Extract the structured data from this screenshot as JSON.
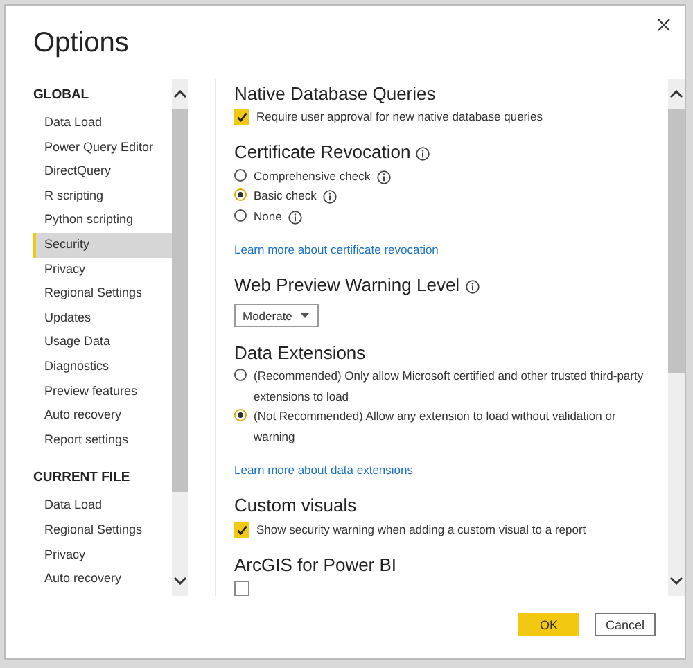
{
  "window": {
    "title": "Options"
  },
  "sidebar": {
    "sections": [
      {
        "heading": "GLOBAL",
        "items": [
          {
            "label": "Data Load",
            "selected": false
          },
          {
            "label": "Power Query Editor",
            "selected": false
          },
          {
            "label": "DirectQuery",
            "selected": false
          },
          {
            "label": "R scripting",
            "selected": false
          },
          {
            "label": "Python scripting",
            "selected": false
          },
          {
            "label": "Security",
            "selected": true
          },
          {
            "label": "Privacy",
            "selected": false
          },
          {
            "label": "Regional Settings",
            "selected": false
          },
          {
            "label": "Updates",
            "selected": false
          },
          {
            "label": "Usage Data",
            "selected": false
          },
          {
            "label": "Diagnostics",
            "selected": false
          },
          {
            "label": "Preview features",
            "selected": false
          },
          {
            "label": "Auto recovery",
            "selected": false
          },
          {
            "label": "Report settings",
            "selected": false
          }
        ]
      },
      {
        "heading": "CURRENT FILE",
        "items": [
          {
            "label": "Data Load",
            "selected": false
          },
          {
            "label": "Regional Settings",
            "selected": false
          },
          {
            "label": "Privacy",
            "selected": false
          },
          {
            "label": "Auto recovery",
            "selected": false
          }
        ]
      }
    ]
  },
  "content": {
    "sections": [
      {
        "title": "Native Database Queries",
        "info": false,
        "items": [
          {
            "kind": "checkbox",
            "label": "Require user approval for new native database queries",
            "checked": true
          }
        ]
      },
      {
        "title": "Certificate Revocation",
        "info": true,
        "items": [
          {
            "kind": "radio",
            "label": "Comprehensive check",
            "info": true,
            "selected": false
          },
          {
            "kind": "radio",
            "label": "Basic check",
            "info": true,
            "selected": true
          },
          {
            "kind": "radio",
            "label": "None",
            "info": true,
            "selected": false
          },
          {
            "kind": "link",
            "label": "Learn more about certificate revocation"
          }
        ]
      },
      {
        "title": "Web Preview Warning Level",
        "info": true,
        "items": [
          {
            "kind": "dropdown",
            "value": "Moderate"
          }
        ]
      },
      {
        "title": "Data Extensions",
        "info": false,
        "items": [
          {
            "kind": "radio",
            "label": "(Recommended) Only allow Microsoft certified and other trusted third-party extensions to load",
            "info": false,
            "selected": false
          },
          {
            "kind": "radio",
            "label": "(Not Recommended) Allow any extension to load without validation or warning",
            "info": false,
            "selected": true
          },
          {
            "kind": "link",
            "label": "Learn more about data extensions"
          }
        ]
      },
      {
        "title": "Custom visuals",
        "info": false,
        "items": [
          {
            "kind": "checkbox",
            "label": "Show security warning when adding a custom visual to a report",
            "checked": true
          }
        ]
      },
      {
        "title": "ArcGIS for Power BI",
        "info": false,
        "items": [
          {
            "kind": "checkbox",
            "checked": false
          }
        ]
      }
    ]
  },
  "buttons": [
    {
      "label": "OK",
      "primary": true
    },
    {
      "label": "Cancel",
      "primary": false
    }
  ]
}
